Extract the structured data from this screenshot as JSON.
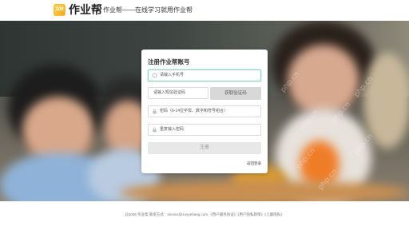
{
  "header": {
    "logo_text": "100",
    "brand": "作业帮",
    "slogan": "作业帮——在线学习就用作业帮"
  },
  "hero": {
    "watermarks": [
      "php.cn",
      "php.cn",
      "php.cn",
      "php.cn",
      "php.cn",
      "php.cn",
      "php.cn"
    ]
  },
  "register": {
    "title": "注册作业帮账号",
    "phone_placeholder": "请输入手机号",
    "sms_placeholder": "请输入短信验证码",
    "sms_button": "获取验证码",
    "password_placeholder": "密码（6-14位字母、数字和符号组合）",
    "repeat_password_placeholder": "重复输入密码",
    "submit_label": "注册",
    "back_to_login": "返回登录"
  },
  "footer": {
    "copyright": "@2006 作业帮 联系方式：service@zuoyebang.com 《用户服务协议》《用户隐私政策》《儿童隐私》"
  },
  "colors": {
    "accent_focus": "#8fd0c0",
    "button_disabled": "#e8e8e8",
    "logo": "#f6a623"
  }
}
